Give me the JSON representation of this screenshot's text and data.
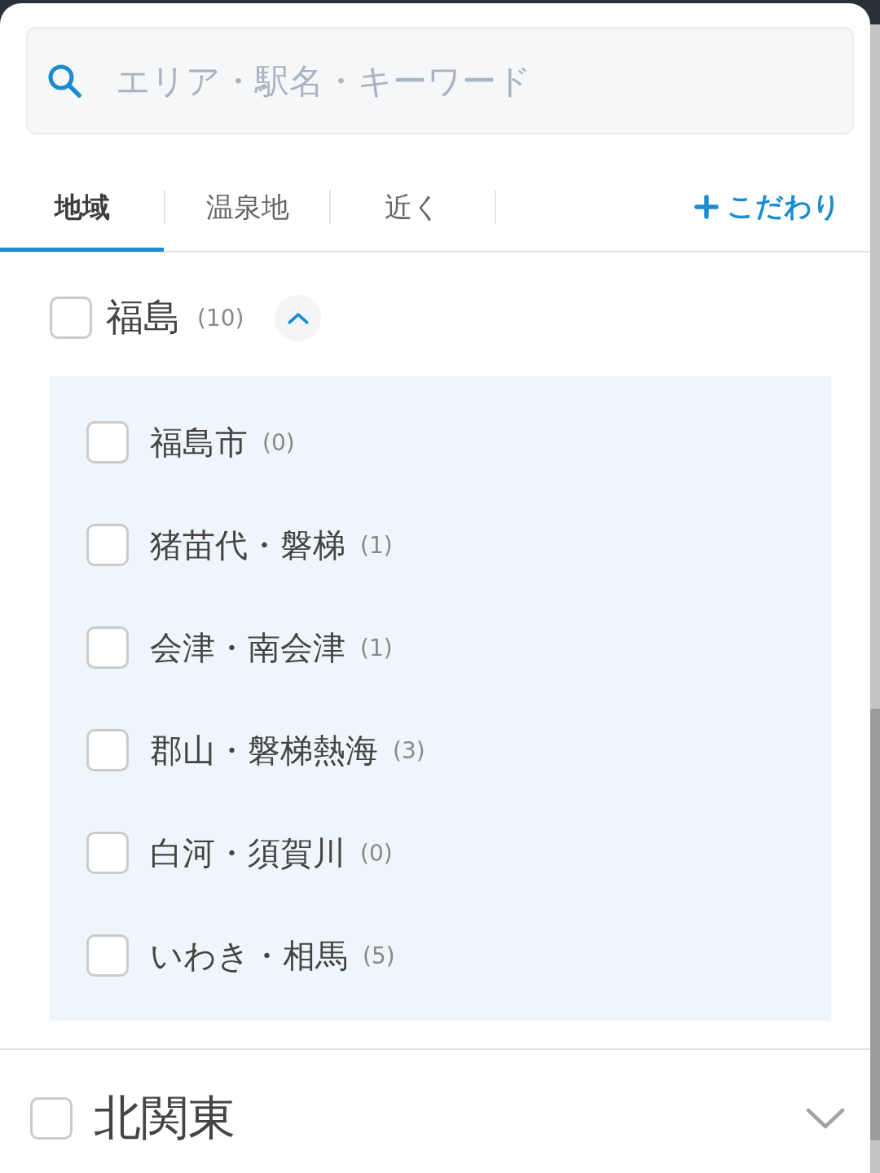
{
  "search": {
    "placeholder": "エリア・駅名・キーワード"
  },
  "tabs": [
    {
      "label": "地域",
      "selected": true
    },
    {
      "label": "温泉地",
      "selected": false
    },
    {
      "label": "近く",
      "selected": false
    }
  ],
  "filter_button": {
    "label": "こだわり"
  },
  "sections": [
    {
      "kind": "prefecture",
      "name": "福島",
      "count": "(10)",
      "checked": false,
      "expanded": true,
      "children": [
        {
          "name": "福島市",
          "count": "(0)",
          "checked": false
        },
        {
          "name": "猪苗代・磐梯",
          "count": "(1)",
          "checked": false
        },
        {
          "name": "会津・南会津",
          "count": "(1)",
          "checked": false
        },
        {
          "name": "郡山・磐梯熱海",
          "count": "(3)",
          "checked": false
        },
        {
          "name": "白河・須賀川",
          "count": "(0)",
          "checked": false
        },
        {
          "name": "いわき・相馬",
          "count": "(5)",
          "checked": false
        }
      ]
    },
    {
      "kind": "area",
      "name": "北関東",
      "checked": false,
      "expanded": false
    }
  ]
}
